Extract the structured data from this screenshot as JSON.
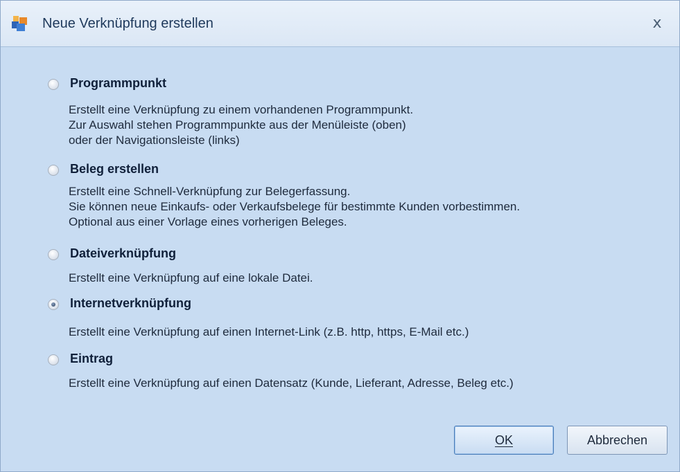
{
  "window": {
    "title": "Neue Verknüpfung erstellen",
    "close_glyph": "x",
    "app_icon": "app-cubes-icon"
  },
  "options": [
    {
      "label": "Programmpunkt",
      "checked": false,
      "description": [
        "Erstellt eine Verknüpfung zu einem vorhandenen Programmpunkt.",
        "Zur Auswahl stehen Programmpunkte aus der Menüleiste (oben)",
        "oder der Navigationsleiste (links)"
      ]
    },
    {
      "label": "Beleg erstellen",
      "checked": false,
      "description": [
        "Erstellt eine Schnell-Verknüpfung zur Belegerfassung.",
        "Sie können neue Einkaufs- oder Verkaufsbelege für bestimmte Kunden vorbestimmen.",
        "Optional aus einer Vorlage eines vorherigen Beleges."
      ]
    },
    {
      "label": "Dateiverknüpfung",
      "checked": false,
      "description": [
        "Erstellt eine Verknüpfung auf eine lokale Datei."
      ]
    },
    {
      "label": "Internetverknüpfung",
      "checked": true,
      "description": [
        "Erstellt eine Verknüpfung auf einen Internet-Link (z.B. http, https, E-Mail etc.)"
      ]
    },
    {
      "label": "Eintrag",
      "checked": false,
      "description": [
        "Erstellt eine Verknüpfung auf einen Datensatz (Kunde, Lieferant, Adresse, Beleg etc.)"
      ]
    }
  ],
  "buttons": {
    "ok_label": "OK",
    "cancel_label": "Abbrechen"
  },
  "colors": {
    "window_bg": "#c8dcf2",
    "titlebar_bg": "#dbe7f5",
    "label_text": "#10203a"
  }
}
